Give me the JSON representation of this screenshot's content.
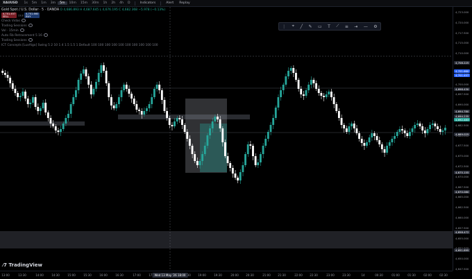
{
  "topbar": {
    "symbol": "XAUUSD",
    "timeframes": [
      "1s",
      "5m",
      "1m",
      "3m",
      "5m",
      "10m",
      "15m",
      "30m",
      "1h",
      "2h",
      "4h",
      "D"
    ],
    "active_timeframe_index": 4,
    "tools": [
      "Indicators",
      "Alert",
      "Replay"
    ]
  },
  "legend": {
    "title": "Gold Spot / U.S. Dollar · 5 · OANDA",
    "ohlc": "O 4,686.893 H 4,687.645 L 4,676.195 C 4,682.368 −5.978 (−0.13%)",
    "sell_price": "4,701.457",
    "sell_label": "SELL",
    "spread": "19.8",
    "buy_price": "4,701.660",
    "buy_label": "BUY",
    "indicators": [
      "Check Vidas",
      "Trading Sessions",
      "Vol · 15min",
      "Auto Fib Retracement 5 16",
      "Trading Sessions",
      "ICT Concepts [LuxAlgo] Swing 5 2 10 1 4 1.5 1.5 1 Default 100 100 100 100 100 100 100 100 100 100"
    ]
  },
  "colors": {
    "up": "#26a69a",
    "down": "#ffffff",
    "accent": "#2962ff",
    "sell": "#b71c1c",
    "buy": "#1e3a6e"
  },
  "icons": [
    "eye-icon",
    "cursor-icon",
    "trend-line-icon",
    "pen-icon",
    "rectangle-icon",
    "text-icon",
    "measure-icon",
    "fib-icon",
    "settings-icon"
  ],
  "currency": "USD",
  "watermark": "TradingView",
  "yaxis": {
    "labels": [
      "4,723.000",
      "4,720.000",
      "4,717.500",
      "4,715.000",
      "4,710.000",
      "4,705.000",
      "4,702.500",
      "4,700.000",
      "4,697.500",
      "4,690.000",
      "4,685.000",
      "4,682.500",
      "4,680.000",
      "4,677.500",
      "4,675.000",
      "4,672.500",
      "4,670.000",
      "4,667.500",
      "4,665.000",
      "4,662.500",
      "4,660.000",
      "4,657.500",
      "4,655.000",
      "4,652.500",
      "4,650.000",
      "4,647.500"
    ],
    "tags": [
      {
        "text": "4,708.225",
        "color": "#2a2e39"
      },
      {
        "text": "4,701.660",
        "color": "#2962ff"
      },
      {
        "text": "4,701.457",
        "color": "#2962ff"
      },
      {
        "text": "4,698.430",
        "color": "#2a2e39"
      },
      {
        "text": "4,694.780",
        "color": "#2a2e39"
      },
      {
        "text": "4,694.235",
        "color": "#2a2e39"
      },
      {
        "text": "4,692.483",
        "color": "#26a69a"
      },
      {
        "text": "4,689.025",
        "color": "#2a2e39"
      },
      {
        "text": "4,675.155",
        "color": "#2a2e39"
      },
      {
        "text": "4,670.080",
        "color": "#2a2e39"
      },
      {
        "text": "4,658.472",
        "color": "#2a2e39"
      },
      {
        "text": "4,651.895",
        "color": "#2a2e39"
      }
    ]
  },
  "xaxis": {
    "labels": [
      "13:00",
      "13:30",
      "14:00",
      "14:30",
      "15:00",
      "15:30",
      "16:00",
      "16:30",
      "17:00",
      "17:30",
      "18:30",
      "19:00",
      "19:30",
      "20:00",
      "20:30",
      "21:00",
      "21:30",
      "22:00",
      "22:30",
      "23:00",
      "23:30",
      "14",
      "00:30",
      "01:00",
      "01:30",
      "02:00",
      "02:30"
    ],
    "cursor_label": "Wed 13 May '26   18:00"
  }
}
